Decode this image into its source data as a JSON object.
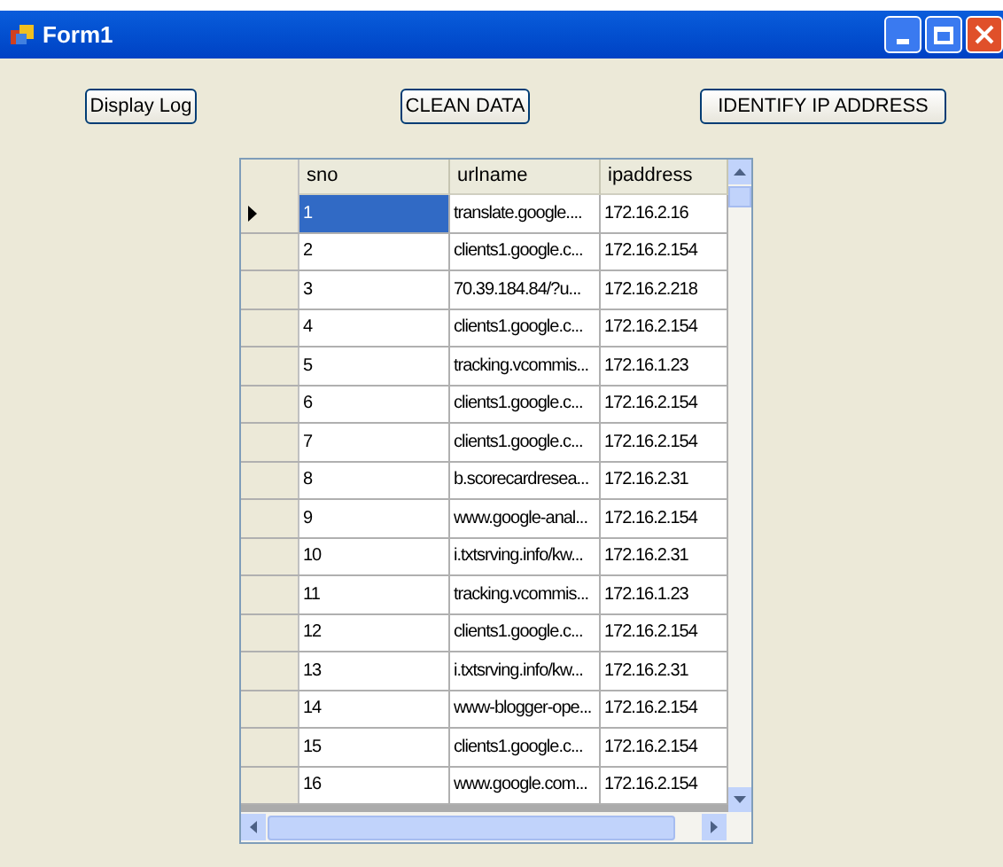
{
  "window": {
    "title": "Form1"
  },
  "buttons": [
    "Display Log",
    "CLEAN DATA",
    "IDENTIFY IP ADDRESS"
  ],
  "table": {
    "columns": [
      "sno",
      "urlname",
      "ipaddress"
    ],
    "rows": [
      {
        "cells": [
          "1",
          "translate.google....",
          "172.16.2.16"
        ],
        "selected": true
      },
      {
        "cells": [
          "2",
          "clients1.google.c...",
          "172.16.2.154"
        ],
        "selected": false
      },
      {
        "cells": [
          "3",
          "70.39.184.84/?u...",
          "172.16.2.218"
        ],
        "selected": false
      },
      {
        "cells": [
          "4",
          "clients1.google.c...",
          "172.16.2.154"
        ],
        "selected": false
      },
      {
        "cells": [
          "5",
          "tracking.vcommis...",
          "172.16.1.23"
        ],
        "selected": false
      },
      {
        "cells": [
          "6",
          "clients1.google.c...",
          "172.16.2.154"
        ],
        "selected": false
      },
      {
        "cells": [
          "7",
          "clients1.google.c...",
          "172.16.2.154"
        ],
        "selected": false
      },
      {
        "cells": [
          "8",
          "b.scorecardresea...",
          "172.16.2.31"
        ],
        "selected": false
      },
      {
        "cells": [
          "9",
          "www.google-anal...",
          "172.16.2.154"
        ],
        "selected": false
      },
      {
        "cells": [
          "10",
          "i.txtsrving.info/kw...",
          "172.16.2.31"
        ],
        "selected": false
      },
      {
        "cells": [
          "11",
          "tracking.vcommis...",
          "172.16.1.23"
        ],
        "selected": false
      },
      {
        "cells": [
          "12",
          "clients1.google.c...",
          "172.16.2.154"
        ],
        "selected": false
      },
      {
        "cells": [
          "13",
          "i.txtsrving.info/kw...",
          "172.16.2.31"
        ],
        "selected": false
      },
      {
        "cells": [
          "14",
          "www-blogger-ope...",
          "172.16.2.154"
        ],
        "selected": false
      },
      {
        "cells": [
          "15",
          "clients1.google.c...",
          "172.16.2.154"
        ],
        "selected": false
      },
      {
        "cells": [
          "16",
          "www.google.com...",
          "172.16.2.154"
        ],
        "selected": false
      }
    ]
  }
}
